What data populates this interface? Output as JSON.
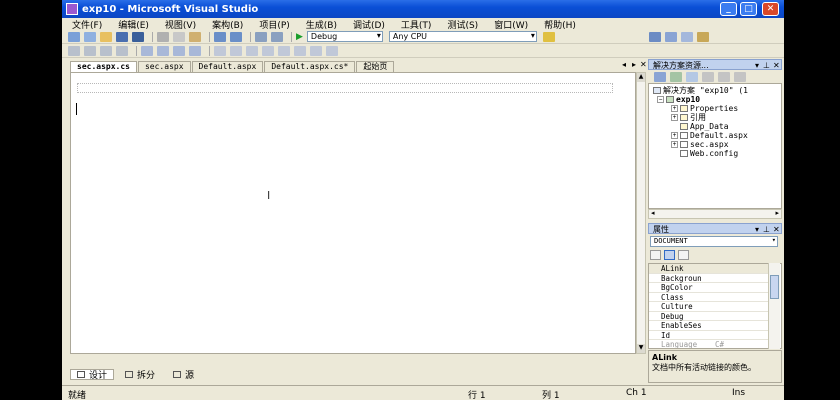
{
  "window": {
    "title": "exp10 - Microsoft Visual Studio"
  },
  "menu": [
    "文件(F)",
    "编辑(E)",
    "视图(V)",
    "案构(B)",
    "项目(P)",
    "生成(B)",
    "调试(D)",
    "工具(T)",
    "测试(S)",
    "窗口(W)",
    "帮助(H)"
  ],
  "toolbar": {
    "config": "Debug",
    "platform": "Any CPU"
  },
  "doc_tabs": [
    "sec.aspx.cs",
    "sec.aspx",
    "Default.aspx",
    "Default.aspx.cs*",
    "起始页"
  ],
  "view_buttons": [
    "设计",
    "拆分",
    "源"
  ],
  "status": {
    "ready": "就绪",
    "line": "行 1",
    "col": "列 1",
    "ch": "Ch 1",
    "ins": "Ins"
  },
  "solution_explorer": {
    "title": "解决方案资源...",
    "solution": "解决方案 \"exp10\" (1",
    "project": "exp10",
    "items": [
      "Properties",
      "引用",
      "App_Data",
      "Default.aspx",
      "sec.aspx",
      "Web.config"
    ]
  },
  "properties": {
    "title": "属性",
    "object": "DOCUMENT",
    "rows": [
      {
        "name": "ALink",
        "value": ""
      },
      {
        "name": "Backgroun",
        "value": ""
      },
      {
        "name": "BgColor",
        "value": ""
      },
      {
        "name": "Class",
        "value": ""
      },
      {
        "name": "Culture",
        "value": ""
      },
      {
        "name": "Debug",
        "value": ""
      },
      {
        "name": "EnableSes",
        "value": ""
      },
      {
        "name": "Id",
        "value": ""
      },
      {
        "name": "Language",
        "value": "C#"
      }
    ],
    "desc_title": "ALink",
    "desc_text": "文档中所有活动链接的颜色。"
  }
}
